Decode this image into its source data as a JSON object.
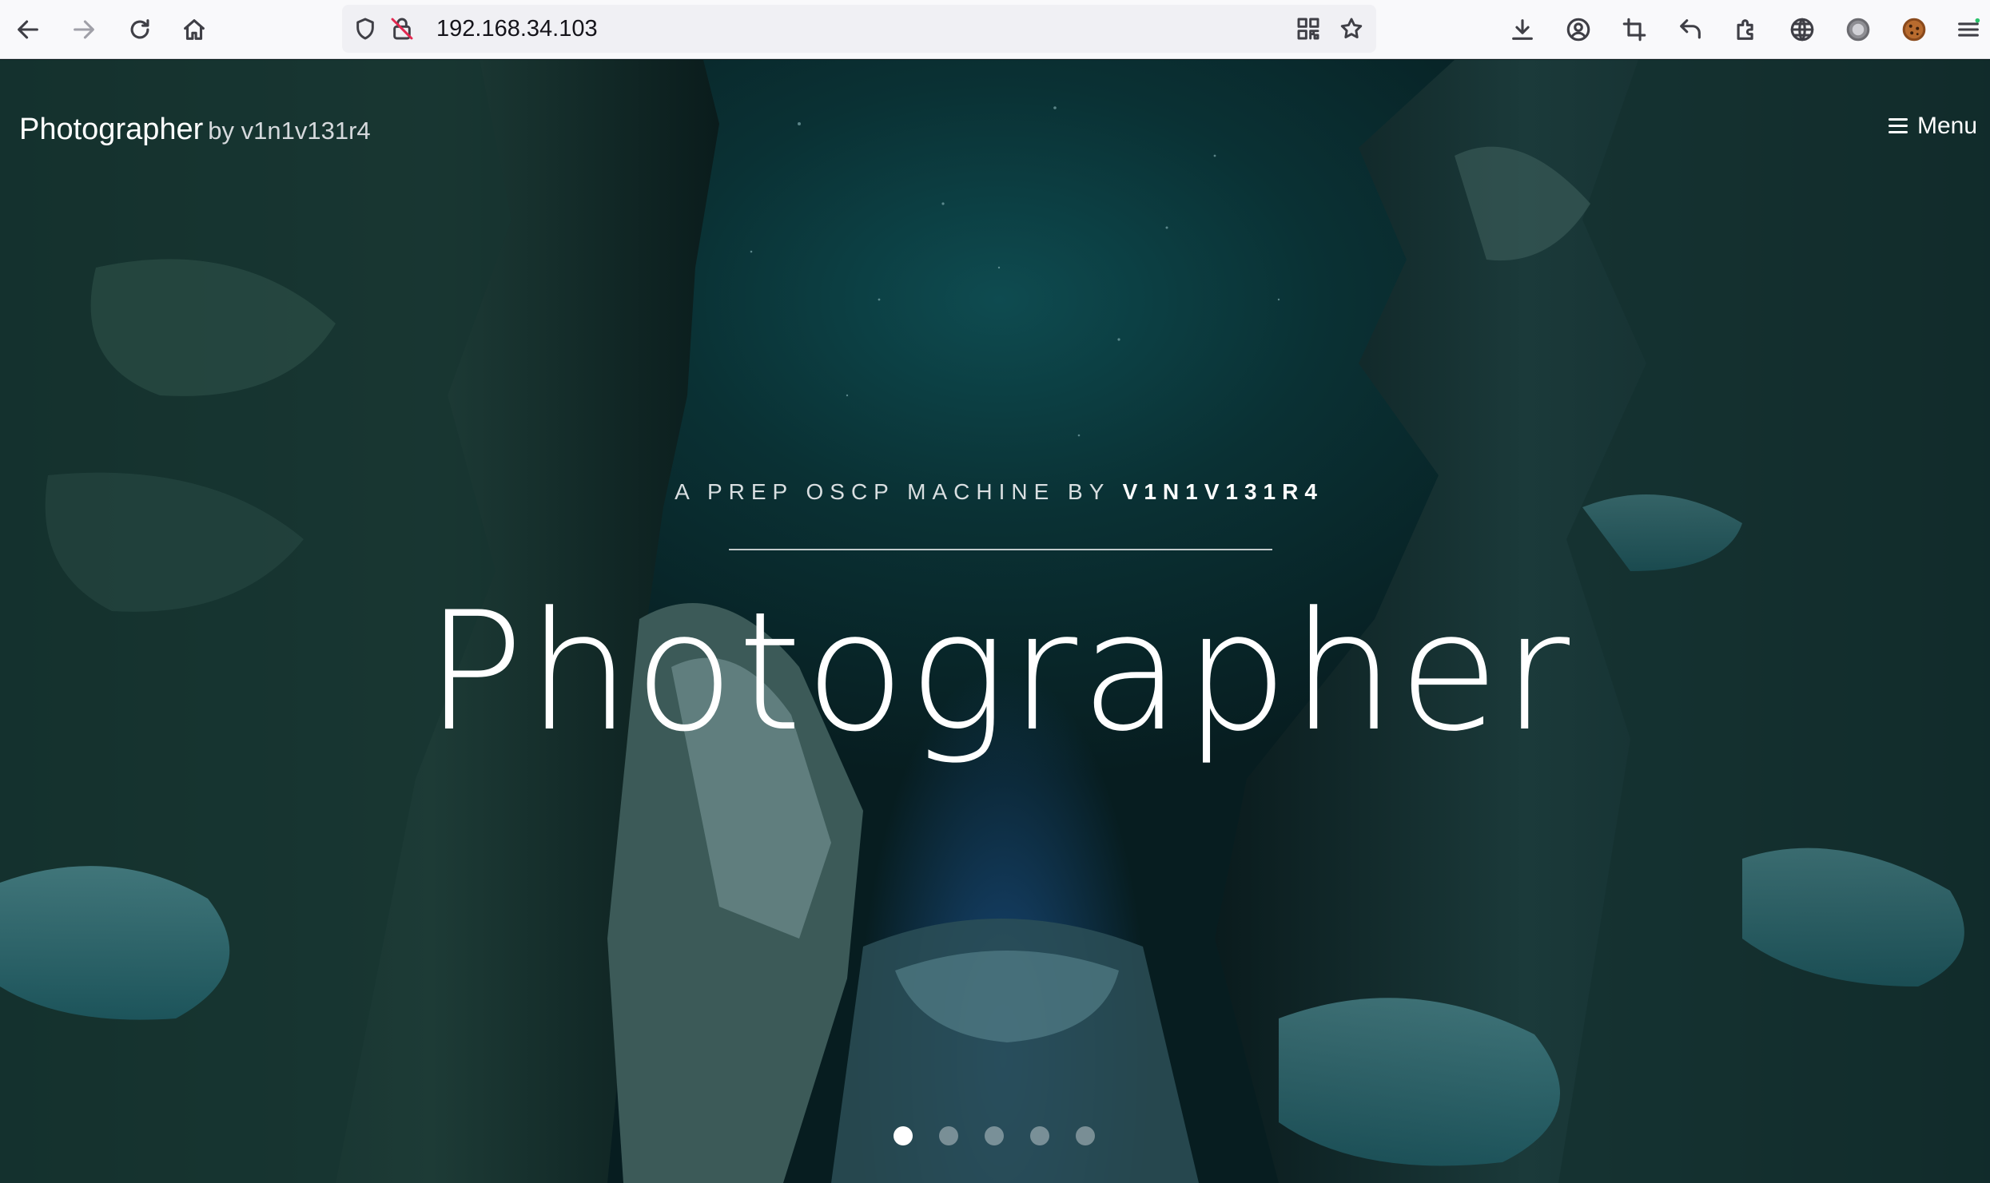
{
  "browser": {
    "url": "192.168.34.103",
    "icons": {
      "back": "back-arrow-icon",
      "forward": "forward-arrow-icon",
      "reload": "reload-icon",
      "home": "home-icon",
      "shield": "tracking-shield-icon",
      "insecure": "insecure-lock-icon",
      "qr": "qr-code-icon",
      "bookmark": "bookmark-star-icon",
      "downloads": "download-icon",
      "account": "account-icon",
      "crop": "crop-icon",
      "undo": "undo-icon",
      "extensions": "extensions-icon",
      "translate": "globe-icon",
      "ext_a": "extension-badge-icon",
      "ext_b": "cookie-icon",
      "app_menu": "app-menu-icon"
    }
  },
  "site": {
    "brand_name": "Photographer",
    "brand_by": "by v1n1v131r4",
    "menu_label": "Menu",
    "subtitle_prefix": "A PREP OSCP MACHINE BY",
    "subtitle_author": "V1N1V131R4",
    "hero_title": "Photographer",
    "slides": {
      "count": 5,
      "active_index": 0
    }
  },
  "colors": {
    "chrome_bg": "#f9f9fb",
    "urlbar_bg": "#f0f0f4",
    "hero_teal": "#0e4b50",
    "text_white": "#ffffff"
  }
}
